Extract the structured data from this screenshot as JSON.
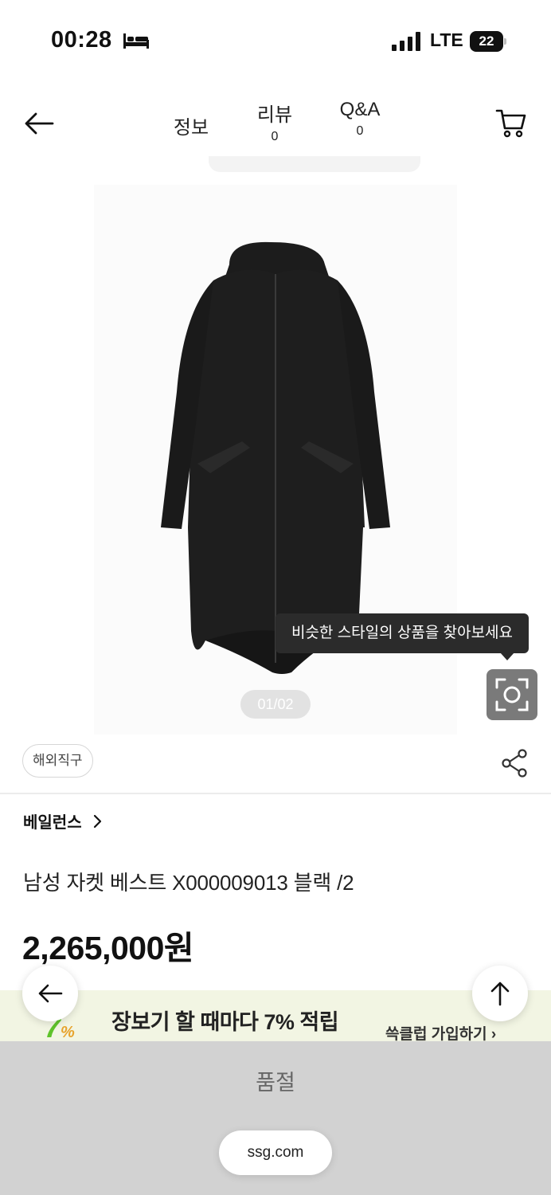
{
  "status_bar": {
    "time": "00:28",
    "network": "LTE",
    "battery": "22",
    "icons": [
      "sleep-bed-icon",
      "signal-icon",
      "battery-icon"
    ]
  },
  "top_nav": {
    "tabs": [
      {
        "label": "정보",
        "count": null
      },
      {
        "label": "리뷰",
        "count": "0"
      },
      {
        "label": "Q&A",
        "count": "0"
      }
    ],
    "icons": [
      "back-arrow-icon",
      "cart-icon"
    ]
  },
  "gallery": {
    "pager": "01/02",
    "tooltip": "비슷한 스타일의 상품을 찾아보세요",
    "icons": [
      "lens-search-icon"
    ]
  },
  "product": {
    "badge": "해외직구",
    "brand": "베일런스",
    "title": "남성 자켓 베스트 X000009013 블랙 /2",
    "price": "2,265,000원",
    "icons": [
      "share-icon",
      "chevron-right-icon"
    ]
  },
  "promo": {
    "logo_number": "7",
    "logo_percent": "%",
    "headline": "장보기 할 때마다 7% 적립",
    "join_label": "쓱클럽 가입하기 ›"
  },
  "floating": {
    "icons": [
      "back-arrow-icon",
      "arrow-up-icon"
    ]
  },
  "bottom": {
    "soldout_label": "품절",
    "url": "ssg.com"
  },
  "colors": {
    "promo_bg": "#f2f5e3",
    "soldout_bg": "#d2d2d2",
    "tooltip_bg": "#2b2b2b",
    "lens_button_bg": "#7a7a7a"
  }
}
